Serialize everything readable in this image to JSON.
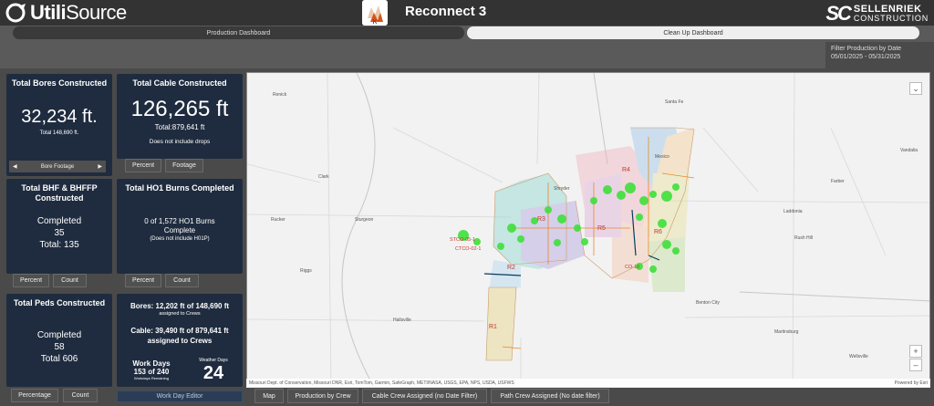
{
  "header": {
    "logo": "UtiliSource",
    "logo_bold": "Utili",
    "logo_thin": "Source",
    "app_title": "Reconnect 3",
    "company_mark": "SC",
    "company_name_1": "SELLENRIEK",
    "company_name_2": "CONSTRUCTION"
  },
  "tabs": [
    {
      "label": "Production Dashboard",
      "active": true
    },
    {
      "label": "Clean Up Dashboard",
      "active": false
    }
  ],
  "filter": {
    "label": "Filter Production by Date",
    "range": "05/01/2025 - 05/31/2025"
  },
  "bores": {
    "title": "Total Bores Constructed",
    "value": "32,234 ft.",
    "total": "Total 148,690 ft.",
    "pager_label": "Bore Footage"
  },
  "cable": {
    "title": "Total Cable Constructed",
    "value": "126,265 ft",
    "total": "Total:879,641 ft",
    "note": "Does not include drops",
    "btn_percent": "Percent",
    "btn_footage": "Footage"
  },
  "bhf": {
    "title_1": "Total BHF & BHFFP",
    "title_2": "Constructed",
    "completed_label": "Completed",
    "completed": "35",
    "total": "Total: 135",
    "btn_percent": "Percent",
    "btn_count": "Count"
  },
  "ho1": {
    "title": "Total HO1 Burns Completed",
    "line1": "0 of 1,572 HO1 Burns",
    "line2": "Complete",
    "note": "(Does not include H01P)",
    "btn_percent": "Percent",
    "btn_count": "Count"
  },
  "peds": {
    "title": "Total Peds Constructed",
    "completed_label": "Completed",
    "completed": "58",
    "total": "Total 606",
    "btn_percentage": "Percentage",
    "btn_count": "Count"
  },
  "crews": {
    "bores_line": "Bores: 12,202 ft of 148,690 ft",
    "bores_sub": "assigned to Crews",
    "cable_line": "Cable: 39,490 ft of 879,641 ft",
    "cable_sub": "assigned to Crews",
    "work_days_label": "Work Days",
    "work_days_value": "153 of 240",
    "work_days_sub": "Workdays Remaining",
    "weather_label": "Weather Days",
    "weather_value": "24",
    "editor_btn": "Work Day Editor"
  },
  "map": {
    "attribution": "Missouri Dept. of Conservation, Missouri DNR, Esri, TomTom, Garmin, SafeGraph, METI/NASA, USGS, EPA, NPS, USDA, USFWS",
    "powered_by": "Powered by Esri",
    "zoom_in": "+",
    "zoom_out": "–",
    "collapse": "⌄",
    "places": [
      {
        "name": "Renick"
      },
      {
        "name": "Santa Fe"
      },
      {
        "name": "Vandalia"
      },
      {
        "name": "Clark"
      },
      {
        "name": "Farber"
      },
      {
        "name": "Sturgeon"
      },
      {
        "name": "Rucker"
      },
      {
        "name": "Laddonia"
      },
      {
        "name": "Rush Hill"
      },
      {
        "name": "Riggs"
      },
      {
        "name": "Benton City"
      },
      {
        "name": "Hallsville"
      },
      {
        "name": "Martinsburg"
      },
      {
        "name": "Wellsville"
      },
      {
        "name": "Mexico"
      },
      {
        "name": "Shryder"
      }
    ],
    "regions": [
      "R1",
      "R2",
      "R3",
      "R4",
      "R5",
      "R6"
    ],
    "site_labels": [
      "STCO-05-1",
      "CTCO-02-1",
      "CO-10"
    ]
  },
  "bottom_tabs": [
    {
      "label": "Map"
    },
    {
      "label": "Production by Crew"
    },
    {
      "label": "Cable Crew Assigned (no Date Filter)"
    },
    {
      "label": "Path Crew Assigned (No date filter)"
    }
  ],
  "colors": {
    "card_bg": "#1f2c3f",
    "page_bg": "#4a4a4a",
    "crew_green": "#39e03a",
    "region_label": "#c0392b"
  }
}
